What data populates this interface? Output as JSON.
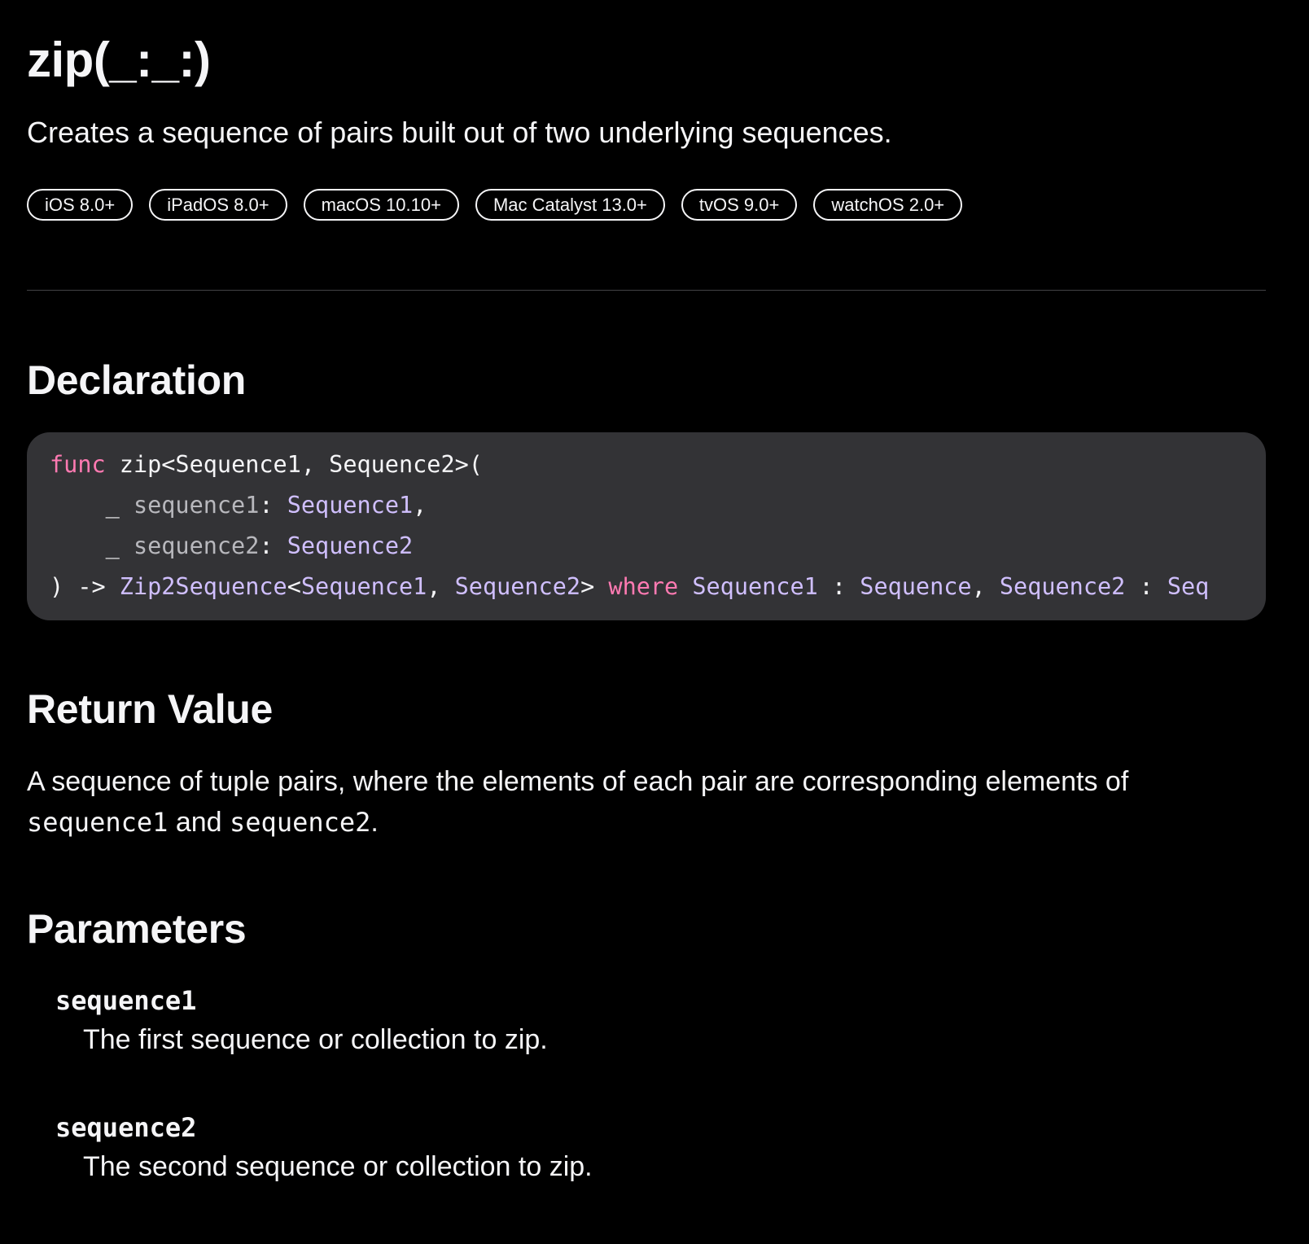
{
  "title": "zip(_:_:)",
  "abstract": "Creates a sequence of pairs built out of two underlying sequences.",
  "availability": [
    "iOS 8.0+",
    "iPadOS 8.0+",
    "macOS 10.10+",
    "Mac Catalyst 13.0+",
    "tvOS 9.0+",
    "watchOS 2.0+"
  ],
  "declaration": {
    "heading": "Declaration",
    "line1": {
      "kw": "func",
      "text": " zip<Sequence1, Sequence2>("
    },
    "line2": {
      "indent": "    _ ",
      "param": "sequence1",
      "colon": ": ",
      "type": "Sequence1",
      "tail": ","
    },
    "line3": {
      "indent": "    _ ",
      "param": "sequence2",
      "colon": ": ",
      "type": "Sequence2"
    },
    "line4": {
      "lead": ") -> ",
      "type1": "Zip2Sequence",
      "lt": "<",
      "type2": "Sequence1",
      "comma1": ", ",
      "type3": "Sequence2",
      "gt": ">",
      "where": " where ",
      "type4": "Sequence1",
      "colon1": " : ",
      "type5": "Sequence",
      "comma2": ", ",
      "type6": "Sequence2",
      "colon2": " : ",
      "type7": "Seq"
    }
  },
  "return_value": {
    "heading": "Return Value",
    "text_prefix": "A sequence of tuple pairs, where the elements of each pair are corresponding elements of ",
    "code1": "sequence1",
    "and": " and ",
    "code2": "sequence2",
    "suffix": "."
  },
  "parameters": {
    "heading": "Parameters",
    "items": [
      {
        "name": "sequence1",
        "description": "The first sequence or collection to zip."
      },
      {
        "name": "sequence2",
        "description": "The second sequence or collection to zip."
      }
    ]
  }
}
